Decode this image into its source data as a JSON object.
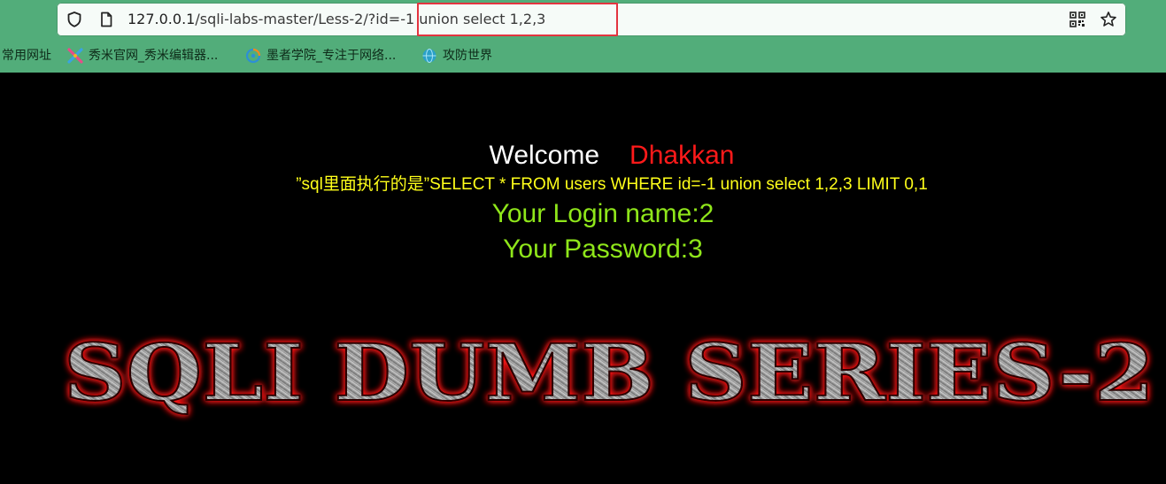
{
  "browser": {
    "url_host": "127.0.0.1",
    "url_path": "/sqli-labs-master/Less-2/?id=-1 union select 1,2,3",
    "icons": {
      "shield": "shield-icon",
      "page": "page-icon",
      "qr": "qr-code-icon",
      "star": "bookmark-star-icon"
    }
  },
  "bookmarks": [
    {
      "label": "常用网址",
      "icon": null
    },
    {
      "label": "秀米官网_秀米编辑器...",
      "icon": "xiumi-icon"
    },
    {
      "label": "墨者学院_专注于网络...",
      "icon": "mozhe-icon"
    },
    {
      "label": "攻防世界",
      "icon": "globe-icon"
    }
  ],
  "page": {
    "welcome": "Welcome",
    "name": "Dhakkan",
    "sql_statement": "”sql里面执行的是”SELECT * FROM users WHERE id=-1 union select 1,2,3 LIMIT 0,1",
    "login_name": "Your Login name:2",
    "password": "Your Password:3",
    "banner": "SQLI DUMB SERIES-2"
  },
  "colors": {
    "chrome_green": "#52ad7a",
    "highlight_red": "#e3343f",
    "welcome_white": "#ffffff",
    "name_red": "#ff1a1a",
    "sql_yellow": "#ffff1a",
    "result_green": "#8fe61a",
    "banner_glow": "#ff2020"
  }
}
